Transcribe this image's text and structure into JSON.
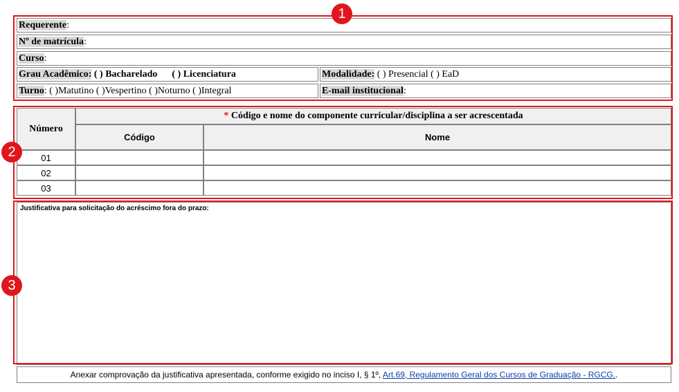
{
  "badges": [
    "1",
    "2",
    "3"
  ],
  "section1": {
    "requerente_label": "Requerente",
    "matricula_label": "Nº de matrícula",
    "curso_label": "Curso",
    "grau_label": "Grau Acadêmico:",
    "grau_options": "( ) Bacharelado      ( ) Licenciatura",
    "modalidade_label": "Modalidade:",
    "modalidade_options": " ( ) Presencial ( ) EaD",
    "turno_label": "Turno",
    "turno_options": ": ( )Matutino ( )Vespertino ( )Noturno ( )Integral",
    "email_label": "E-mail institucional",
    "colon": ":"
  },
  "section2": {
    "numero_header": "Número",
    "star": "*",
    "componente_header": " Código e nome do componente curricular/disciplina a ser acrescentada",
    "codigo_header": "Código",
    "nome_header": "Nome",
    "rows": [
      "01",
      "02",
      "03"
    ]
  },
  "section3": {
    "justificativa_label": "Justificativa para solicitação do acréscimo fora do prazo:"
  },
  "footer": {
    "text": "Anexar comprovação da justificativa apresentada, conforme exigido no inciso I, § 1º, ",
    "link": "Art.69, Regulamento Geral dos Cursos de Graduação - RGCG.",
    "end": "."
  }
}
